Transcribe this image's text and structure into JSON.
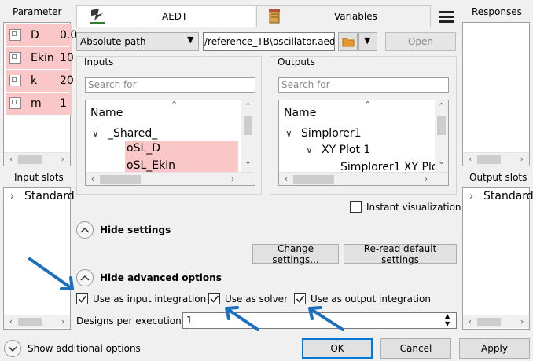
{
  "left_panel": {
    "title": "Parameter",
    "parameters": [
      {
        "name": "D",
        "value": "0.0"
      },
      {
        "name": "Ekin",
        "value": "10"
      },
      {
        "name": "k",
        "value": "20"
      },
      {
        "name": "m",
        "value": "1"
      }
    ],
    "input_slots_title": "Input slots",
    "input_slots": [
      {
        "label": "Standard"
      }
    ]
  },
  "tabs": [
    {
      "label": "AEDT",
      "icon": "aedt-logo-icon"
    },
    {
      "label": "Variables",
      "icon": "variables-icon"
    }
  ],
  "menu_icon": "hamburger-menu-icon",
  "path_row": {
    "path_type": "Absolute path",
    "path_value": "/reference_TB\\oscillator.aedt",
    "open_label": "Open"
  },
  "inputs": {
    "label": "Inputs",
    "search_placeholder": "Search for",
    "header": "Name",
    "items": [
      {
        "label": "_Shared_"
      },
      {
        "label": "oSL_D"
      },
      {
        "label": "oSL_Ekin"
      }
    ]
  },
  "outputs": {
    "label": "Outputs",
    "search_placeholder": "Search for",
    "header": "Name",
    "items": [
      {
        "label": "Simplorer1"
      },
      {
        "label": "XY Plot 1"
      },
      {
        "label": "Simplorer1 XY Plo"
      }
    ]
  },
  "instant_visualization": {
    "label": "Instant visualization",
    "checked": false
  },
  "settings": {
    "hide_settings_label": "Hide settings",
    "change_settings_label": "Change settings...",
    "reread_label": "Re-read default settings"
  },
  "advanced": {
    "hide_advanced_label": "Hide advanced options",
    "input_integration": {
      "label": "Use as input integration",
      "checked": true
    },
    "solver": {
      "label": "Use as solver",
      "checked": true
    },
    "output_integration": {
      "label": "Use as output integration",
      "checked": true
    },
    "designs_label": "Designs per execution:",
    "designs_value": "1"
  },
  "right_panel": {
    "title": "Responses",
    "output_slots_title": "Output slots",
    "output_slots": [
      {
        "label": "Standard"
      }
    ]
  },
  "footer": {
    "show_additional_label": "Show additional options",
    "ok_label": "OK",
    "cancel_label": "Cancel",
    "apply_label": "Apply"
  },
  "colors": {
    "highlight": "#f9c7c7",
    "arrow_annotation": "#1a6fc0",
    "ok_border": "#0078d7"
  }
}
